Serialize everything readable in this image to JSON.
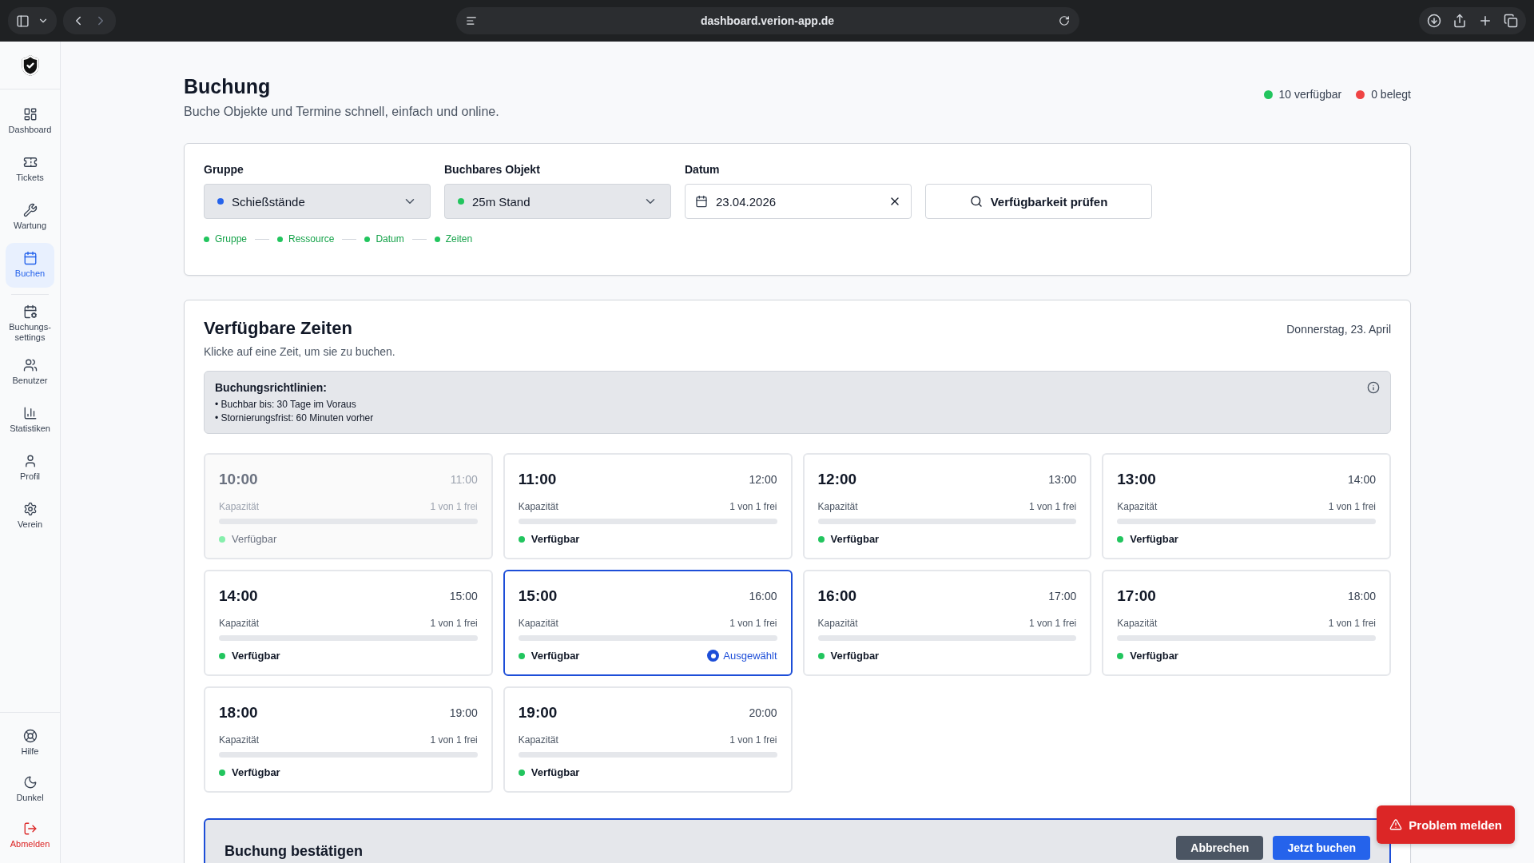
{
  "browser": {
    "url": "dashboard.verion-app.de"
  },
  "sidebar": {
    "items": [
      {
        "label": "Dashboard",
        "kind": "dashboard",
        "selected": false
      },
      {
        "label": "Tickets",
        "kind": "ticket",
        "selected": false
      },
      {
        "label": "Wartung",
        "kind": "wrench",
        "selected": false
      },
      {
        "label": "Buchen",
        "kind": "calendar",
        "selected": true
      },
      {
        "label": "Buchungs-settings",
        "kind": "calendar-cog",
        "selected": false
      },
      {
        "label": "Benutzer",
        "kind": "users",
        "selected": false
      },
      {
        "label": "Statistiken",
        "kind": "chart",
        "selected": false
      },
      {
        "label": "Profil",
        "kind": "user",
        "selected": false
      },
      {
        "label": "Verein",
        "kind": "gear",
        "selected": false
      }
    ],
    "bottom_items": [
      {
        "label": "Hilfe",
        "kind": "help"
      },
      {
        "label": "Dunkel",
        "kind": "moon"
      },
      {
        "label": "Abmelden",
        "kind": "logout"
      }
    ]
  },
  "header": {
    "title": "Buchung",
    "subtitle": "Buche Objekte und Termine schnell, einfach und online.",
    "stats": [
      {
        "label": "10 verfügbar",
        "color": "#22c55e"
      },
      {
        "label": "0 belegt",
        "color": "#ef4444"
      }
    ]
  },
  "filters": {
    "group": {
      "label": "Gruppe",
      "value": "Schießstände",
      "color": "#2563eb"
    },
    "object": {
      "label": "Buchbares Objekt",
      "value": "25m Stand",
      "color": "#22c55e"
    },
    "date": {
      "label": "Datum",
      "value": "23.04.2026"
    },
    "check_button": "Verfügbarkeit prüfen",
    "steps": [
      {
        "label": "Gruppe",
        "color": "#22c55e"
      },
      {
        "label": "Ressource",
        "color": "#22c55e"
      },
      {
        "label": "Datum",
        "color": "#22c55e"
      },
      {
        "label": "Zeiten",
        "color": "#22c55e"
      }
    ]
  },
  "times": {
    "title": "Verfügbare Zeiten",
    "subtitle": "Klicke auf eine Zeit, um sie zu buchen.",
    "date": "Donnerstag, 23. April",
    "policy": {
      "title": "Buchungsrichtlinien:",
      "lines": [
        "• Buchbar bis: 30 Tage im Voraus",
        "• Stornierungsfrist: 60 Minuten vorher"
      ]
    },
    "slots": [
      {
        "start": "10:00",
        "end": "11:00",
        "capacity_label": "Kapazität",
        "capacity_value": "1 von 1 frei",
        "level": 0,
        "status": "Verfügbar",
        "disabled": true,
        "selected": false
      },
      {
        "start": "11:00",
        "end": "12:00",
        "capacity_label": "Kapazität",
        "capacity_value": "1 von 1 frei",
        "level": 0,
        "status": "Verfügbar",
        "disabled": false,
        "selected": false
      },
      {
        "start": "12:00",
        "end": "13:00",
        "capacity_label": "Kapazität",
        "capacity_value": "1 von 1 frei",
        "level": 0,
        "status": "Verfügbar",
        "disabled": false,
        "selected": false
      },
      {
        "start": "13:00",
        "end": "14:00",
        "capacity_label": "Kapazität",
        "capacity_value": "1 von 1 frei",
        "level": 0,
        "status": "Verfügbar",
        "disabled": false,
        "selected": false
      },
      {
        "start": "14:00",
        "end": "15:00",
        "capacity_label": "Kapazität",
        "capacity_value": "1 von 1 frei",
        "level": 0,
        "status": "Verfügbar",
        "disabled": false,
        "selected": false
      },
      {
        "start": "15:00",
        "end": "16:00",
        "capacity_label": "Kapazität",
        "capacity_value": "1 von 1 frei",
        "level": 0,
        "status": "Verfügbar",
        "disabled": false,
        "selected": true,
        "badge": "Ausgewählt"
      },
      {
        "start": "16:00",
        "end": "17:00",
        "capacity_label": "Kapazität",
        "capacity_value": "1 von 1 frei",
        "level": 0,
        "status": "Verfügbar",
        "disabled": false,
        "selected": false
      },
      {
        "start": "17:00",
        "end": "18:00",
        "capacity_label": "Kapazität",
        "capacity_value": "1 von 1 frei",
        "level": 0,
        "status": "Verfügbar",
        "disabled": false,
        "selected": false
      },
      {
        "start": "18:00",
        "end": "19:00",
        "capacity_label": "Kapazität",
        "capacity_value": "1 von 1 frei",
        "level": 0,
        "status": "Verfügbar",
        "disabled": false,
        "selected": false
      },
      {
        "start": "19:00",
        "end": "20:00",
        "capacity_label": "Kapazität",
        "capacity_value": "1 von 1 frei",
        "level": 0,
        "status": "Verfügbar",
        "disabled": false,
        "selected": false
      }
    ]
  },
  "confirm": {
    "title": "Buchung bestätigen",
    "buttons": [
      {
        "label": "Abbrechen",
        "kind": "secondary"
      },
      {
        "label": "Jetzt buchen",
        "kind": "primary"
      }
    ]
  },
  "problem_button": "Problem melden"
}
